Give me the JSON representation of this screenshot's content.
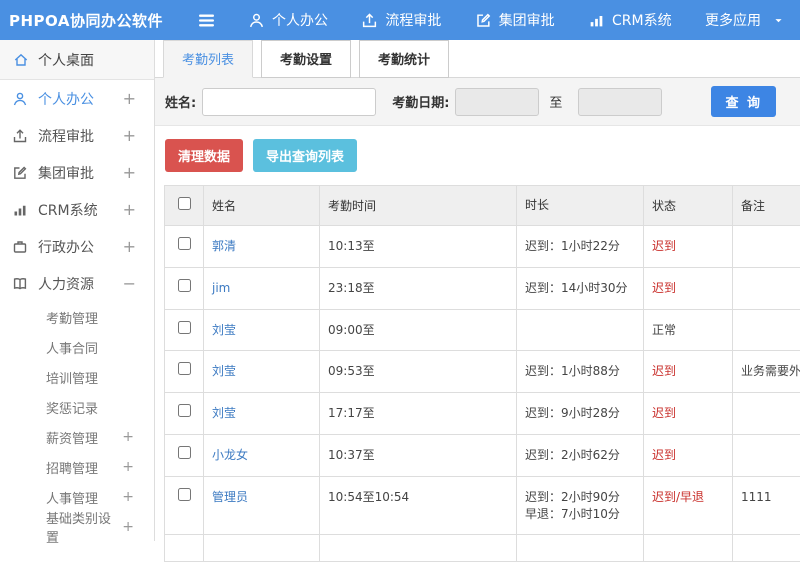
{
  "app": {
    "logo": "PHPOA协同办公软件"
  },
  "topnav": {
    "items": [
      {
        "label": "个人办公",
        "icon": "user-icon"
      },
      {
        "label": "流程审批",
        "icon": "upload-icon"
      },
      {
        "label": "集团审批",
        "icon": "edit-icon"
      },
      {
        "label": "CRM系统",
        "icon": "chart-icon"
      },
      {
        "label": "更多应用",
        "icon": "caret-down-icon"
      }
    ]
  },
  "sidebar": {
    "desktop": {
      "label": "个人桌面"
    },
    "items": [
      {
        "label": "个人办公",
        "expander": "+",
        "active": true
      },
      {
        "label": "流程审批",
        "expander": "+"
      },
      {
        "label": "集团审批",
        "expander": "+"
      },
      {
        "label": "CRM系统",
        "expander": "+"
      },
      {
        "label": "行政办公",
        "expander": "+"
      },
      {
        "label": "人力资源",
        "expander": "−"
      }
    ],
    "sub_items": [
      {
        "label": "考勤管理",
        "expander": ""
      },
      {
        "label": "人事合同",
        "expander": ""
      },
      {
        "label": "培训管理",
        "expander": ""
      },
      {
        "label": "奖惩记录",
        "expander": ""
      },
      {
        "label": "薪资管理",
        "expander": "+"
      },
      {
        "label": "招聘管理",
        "expander": "+"
      },
      {
        "label": "人事管理",
        "expander": "+"
      },
      {
        "label": "基础类别设置",
        "expander": "+"
      }
    ]
  },
  "tabs": [
    {
      "label": "考勤列表",
      "active": true
    },
    {
      "label": "考勤设置",
      "active": false
    },
    {
      "label": "考勤统计",
      "active": false
    }
  ],
  "filter": {
    "name_label": "姓名:",
    "name_value": "",
    "date_label": "考勤日期:",
    "date_from_value": "",
    "to_label": "至",
    "date_to_value": "",
    "query_button": "查 询"
  },
  "actions": {
    "clear_button": "清理数据",
    "export_button": "导出查询列表"
  },
  "table": {
    "headers": [
      "姓名",
      "考勤时间",
      "时长",
      "状态",
      "备注"
    ],
    "rows": [
      {
        "name": "郭清",
        "time": "10:13至",
        "duration": "迟到：1小时22分",
        "status": "迟到",
        "status_red": true,
        "remark": ""
      },
      {
        "name": "jim",
        "time": "23:18至",
        "duration": "迟到：14小时30分",
        "status": "迟到",
        "status_red": true,
        "remark": ""
      },
      {
        "name": "刘莹",
        "time": "09:00至",
        "duration": "",
        "status": "正常",
        "status_red": false,
        "remark": ""
      },
      {
        "name": "刘莹",
        "time": "09:53至",
        "duration": "迟到：1小时88分",
        "status": "迟到",
        "status_red": true,
        "remark": "业务需要外出"
      },
      {
        "name": "刘莹",
        "time": "17:17至",
        "duration": "迟到：9小时28分",
        "status": "迟到",
        "status_red": true,
        "remark": ""
      },
      {
        "name": "小龙女",
        "time": "10:37至",
        "duration": "迟到：2小时62分",
        "status": "迟到",
        "status_red": true,
        "remark": ""
      },
      {
        "name": "管理员",
        "time": "10:54至10:54",
        "duration": "迟到：2小时90分\n早退：7小时10分",
        "status": "迟到/早退",
        "status_red": true,
        "remark": "1111"
      }
    ]
  },
  "colors": {
    "topbar_blue": "#4a90e2",
    "query_blue": "#3d85e4",
    "danger_red": "#d9534f",
    "info_blue": "#5bc0de",
    "status_red": "#c9302c",
    "link_blue": "#3c7ac2"
  }
}
